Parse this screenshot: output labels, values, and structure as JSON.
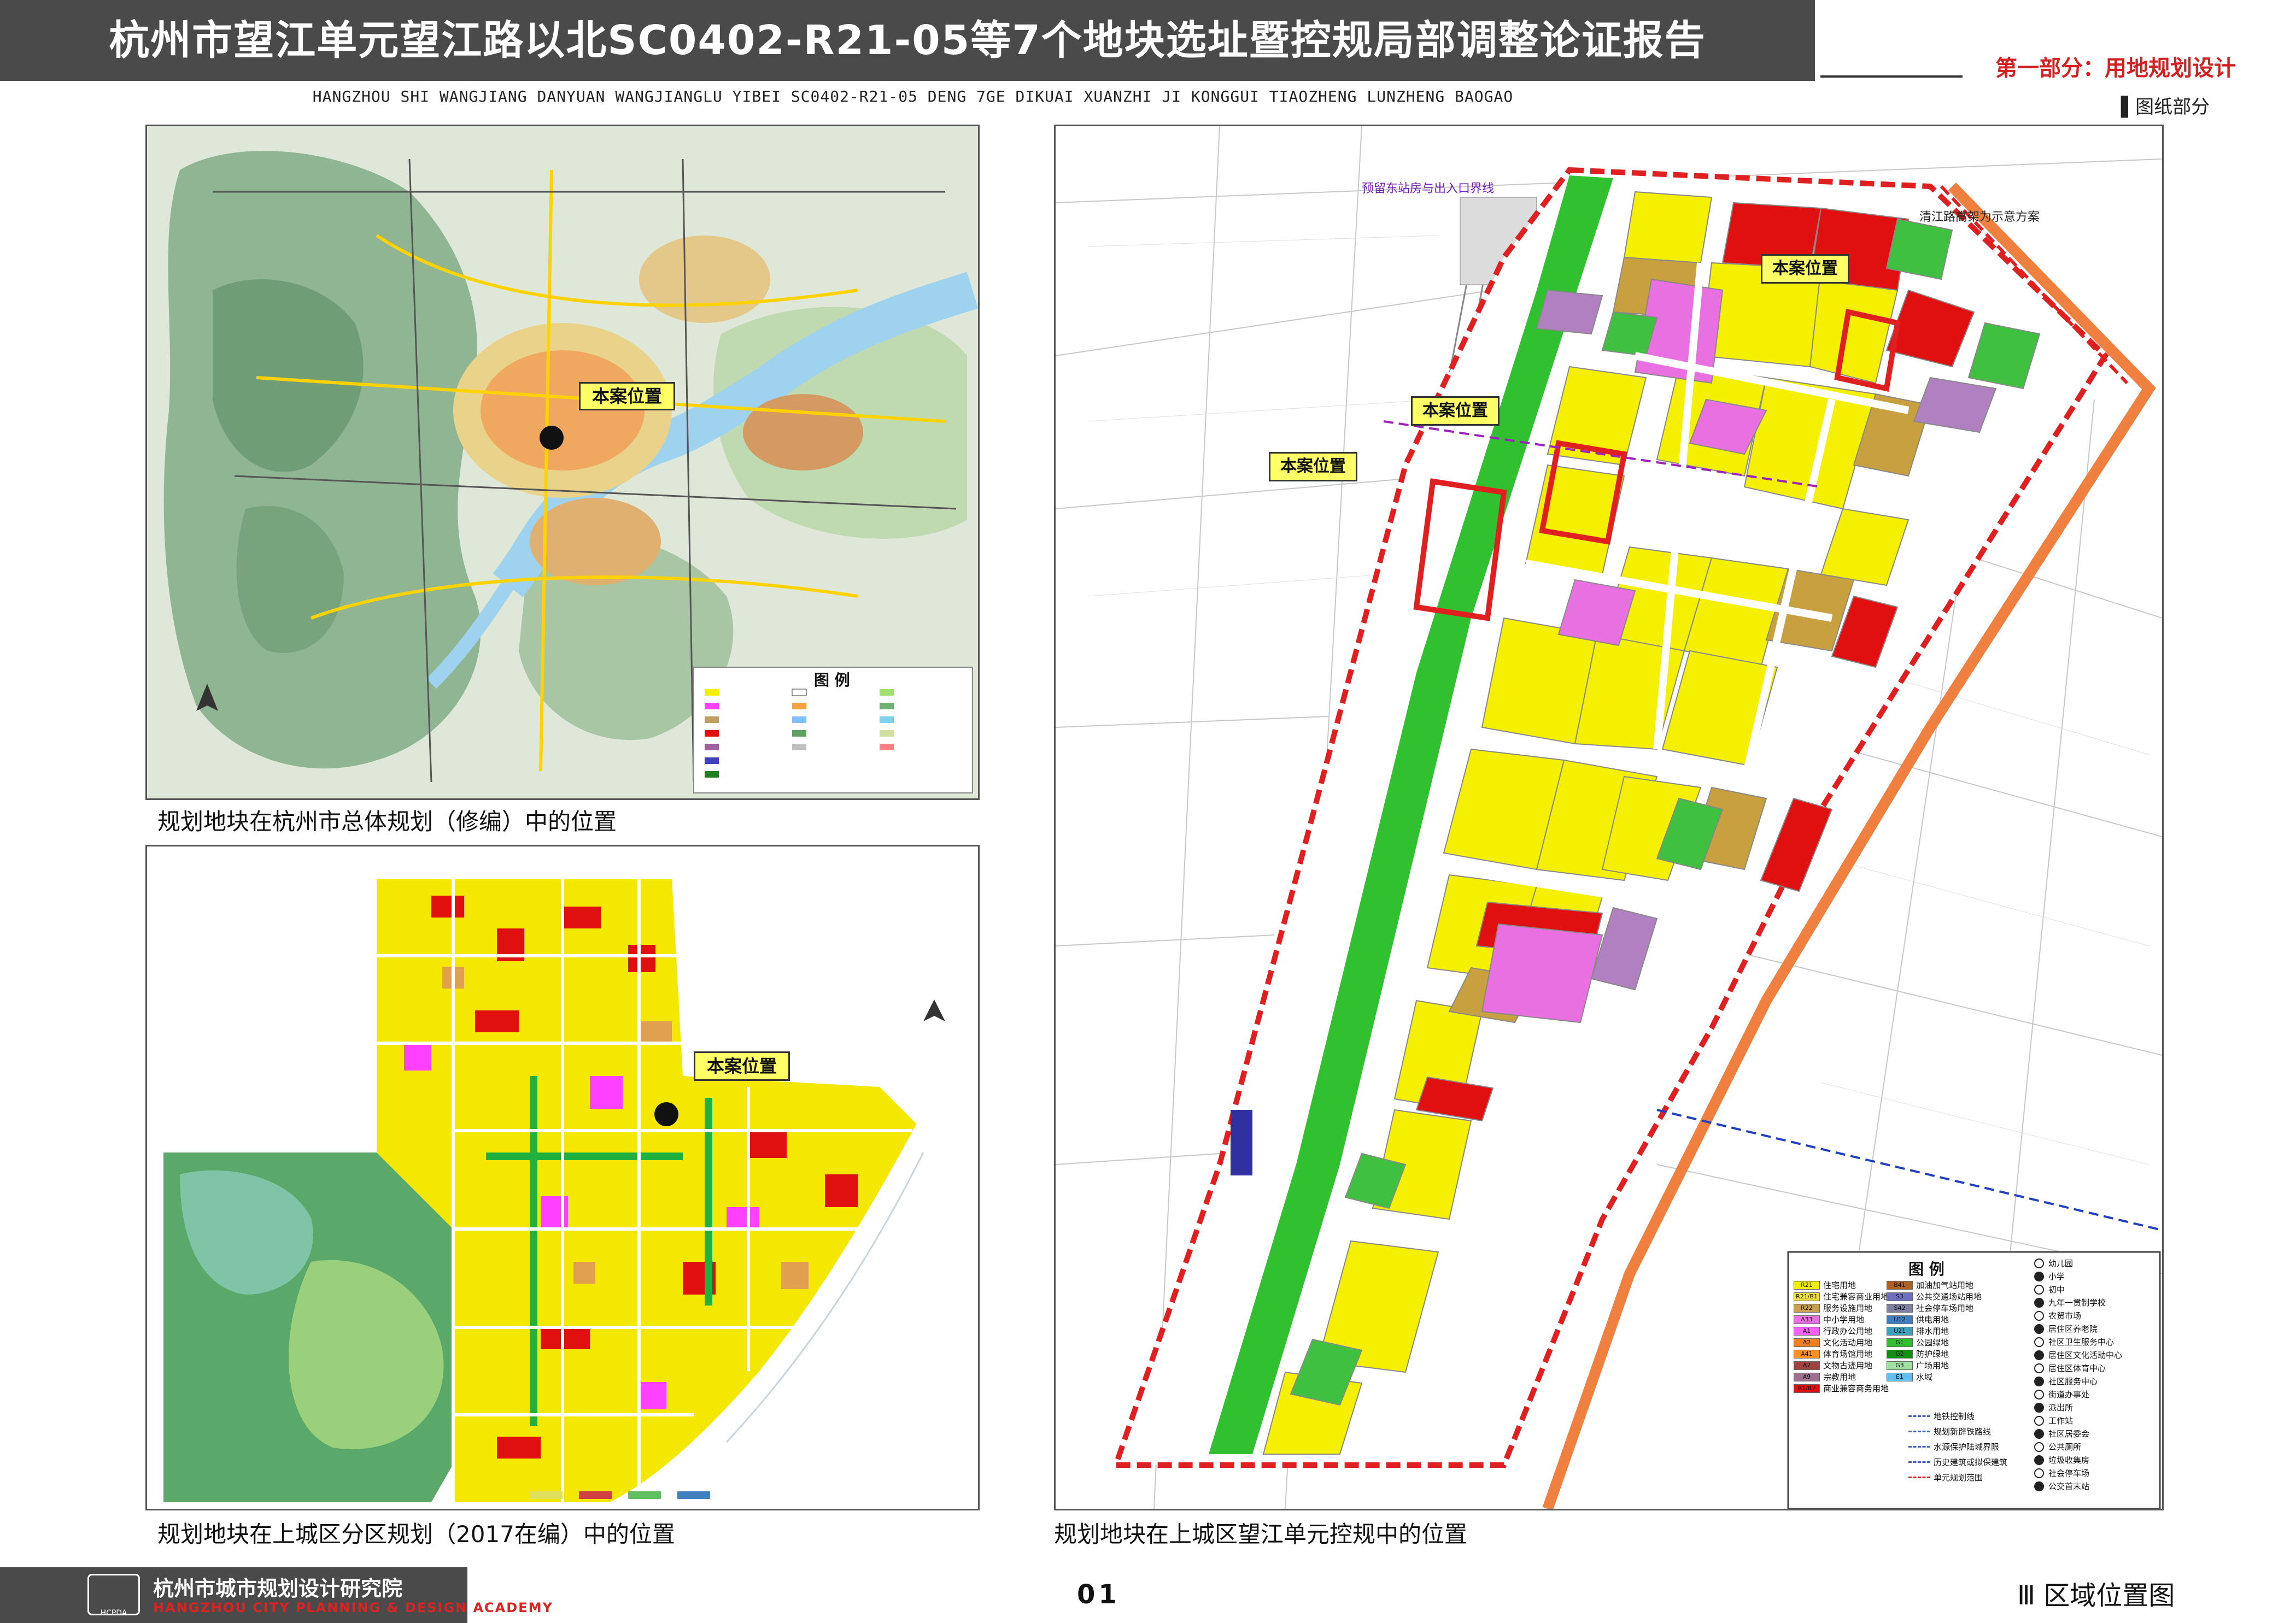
{
  "header": {
    "title": "杭州市望江单元望江路以北SC0402-R21-05等7个地块选址暨控规局部调整论证报告",
    "section_label": "第一部分：用地规划设计",
    "subtitle": "HANGZHOU SHI WANGJIANG DANYUAN WANGJIANGLU YIBEI SC0402-R21-05 DENG 7GE DIKUAI XUANZHI JI KONGGUI TIAOZHENG LUNZHENG BAOGAO",
    "drawing_part": "▌图纸部分"
  },
  "maps": {
    "site_tag": "本案位置",
    "top_left": {
      "caption": "规划地块在杭州市总体规划（修编）中的位置",
      "legend_title": "图 例"
    },
    "bottom_left": {
      "caption": "规划地块在上城区分区规划（2017在编）中的位置"
    },
    "right": {
      "caption": "规划地块在上城区望江单元控规中的位置",
      "legend_title": "图 例",
      "note_top": "预留东站房与出入口界线",
      "note_right": "清江路高架为示意方案",
      "legend_items": [
        {
          "code": "R21",
          "label": "住宅用地",
          "color": "#f2f200"
        },
        {
          "code": "R21/B1",
          "label": "住宅兼容商业用地",
          "color": "#f0e040"
        },
        {
          "code": "R22",
          "label": "服务设施用地",
          "color": "#c8a050"
        },
        {
          "code": "A33",
          "label": "中小学用地",
          "color": "#e870e0"
        },
        {
          "code": "A1",
          "label": "行政办公用地",
          "color": "#ff60ff"
        },
        {
          "code": "A2",
          "label": "文化活动用地",
          "color": "#f08020"
        },
        {
          "code": "A41",
          "label": "体育场馆用地",
          "color": "#ff9020"
        },
        {
          "code": "A7",
          "label": "文物古迹用地",
          "color": "#a04040"
        },
        {
          "code": "A9",
          "label": "宗教用地",
          "color": "#a07090"
        },
        {
          "code": "B1/B2",
          "label": "商业兼容商务用地",
          "color": "#e01010"
        },
        {
          "code": "B41",
          "label": "加油加气站用地",
          "color": "#b06020"
        },
        {
          "code": "S3",
          "label": "公共交通场站用地",
          "color": "#7070c0"
        },
        {
          "code": "S42",
          "label": "社会停车场用地",
          "color": "#8080a0"
        },
        {
          "code": "U12",
          "label": "供电用地",
          "color": "#4080c0"
        },
        {
          "code": "U21",
          "label": "排水用地",
          "color": "#40a0c0"
        },
        {
          "code": "G1",
          "label": "公园绿地",
          "color": "#30c030"
        },
        {
          "code": "G2",
          "label": "防护绿地",
          "color": "#109010"
        },
        {
          "code": "G3",
          "label": "广场用地",
          "color": "#a0e0a0"
        },
        {
          "code": "E1",
          "label": "水域",
          "color": "#60c0f0"
        }
      ],
      "line_items": [
        "地铁控制线",
        "规划新辟铁路线",
        "水源保护陆域界限",
        "历史建筑或拟保建筑",
        "单元规划范围"
      ],
      "symbol_items": [
        "幼儿园",
        "小学",
        "初中",
        "九年一贯制学校",
        "农贸市场",
        "居住区养老院",
        "社区卫生服务中心",
        "居住区文化活动中心",
        "居住区体育中心",
        "社区服务中心",
        "街道办事处",
        "派出所",
        "工作站",
        "社区居委会",
        "公共厕所",
        "垃圾收集房",
        "社会停车场",
        "公交首末站"
      ]
    }
  },
  "footer": {
    "org_cn": "杭州市城市规划设计研究院",
    "org_en": "HANGZHOU CITY PLANNING & DESIGN ACADEMY",
    "logo_text": "HCPDA",
    "page_number": "01",
    "sheet_title": "Ⅲ  区域位置图"
  }
}
